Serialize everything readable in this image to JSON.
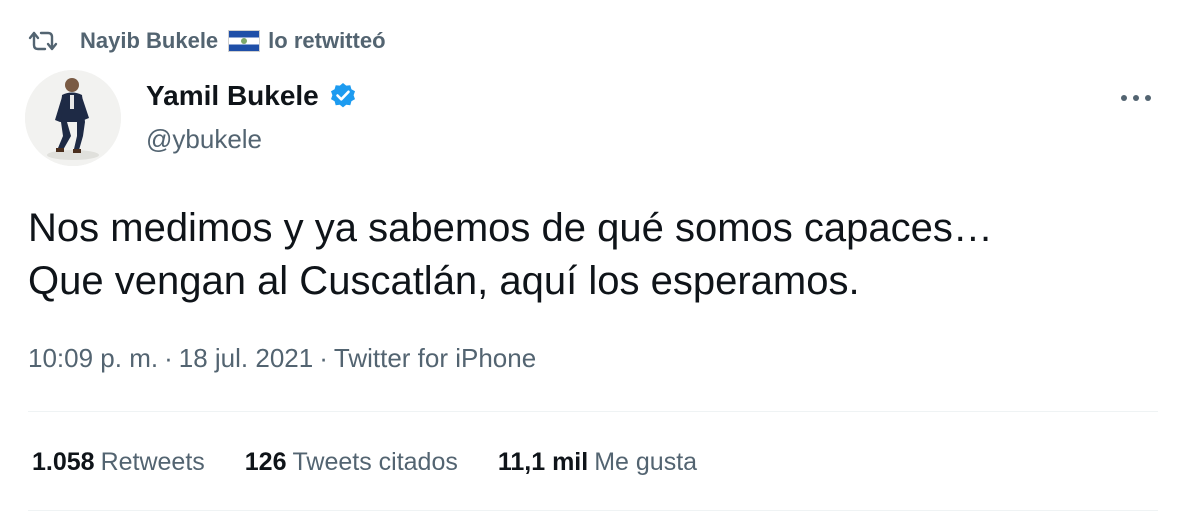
{
  "retweet": {
    "icon": "retweet-icon",
    "user": "Nayib Bukele",
    "flag": "el-salvador-flag-icon",
    "action": "lo retwitteó"
  },
  "author": {
    "name": "Yamil Bukele",
    "handle": "@ybukele",
    "verified": true,
    "verified_color": "#1d9bf0"
  },
  "tweet": {
    "text": "Nos medimos y ya sabemos de qué somos capaces…\nQue vengan al Cuscatlán, aquí los esperamos.",
    "time": "10:09 p. m.",
    "date": "18 jul. 2021",
    "source": "Twitter for iPhone",
    "separator": "·"
  },
  "stats": {
    "retweets": {
      "value": "1.058",
      "label": "Retweets"
    },
    "quotes": {
      "value": "126",
      "label": "Tweets citados"
    },
    "likes": {
      "value": "11,1 mil",
      "label": "Me gusta"
    }
  },
  "colors": {
    "text_primary": "#0f1419",
    "text_secondary": "#536471",
    "divider": "#eff3f4"
  }
}
